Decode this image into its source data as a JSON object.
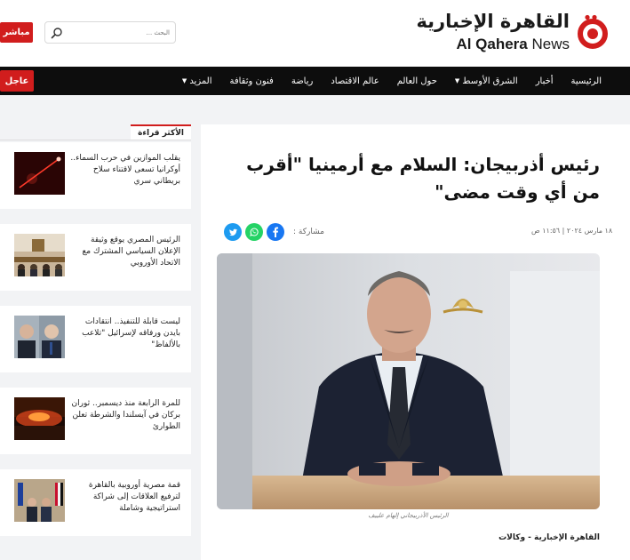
{
  "header": {
    "live_label": "مباشر",
    "search_placeholder": "البحث ...",
    "logo_ar": "القاهرة الإخبارية",
    "logo_en_bold": "Al Qahera",
    "logo_en_light": "News"
  },
  "nav": {
    "urgent_label": "عاجل",
    "items": [
      {
        "label": "الرئيسية"
      },
      {
        "label": "أخبار"
      },
      {
        "label": "الشرق الأوسط"
      },
      {
        "label": "حول العالم"
      },
      {
        "label": "عالم الاقتصاد"
      },
      {
        "label": "رياضة"
      },
      {
        "label": "فنون وثقافة"
      },
      {
        "label": "المزيد"
      }
    ]
  },
  "sidebar": {
    "title": "الأكثر قراءة",
    "items": [
      {
        "text": "يقلب الموازين في حرب السماء.. أوكرانيا تسعى لاقتناء سلاح بريطاني سري"
      },
      {
        "text": "الرئيس المصري يوقع وثيقة الإعلان السياسي المشترك مع الاتحاد الأوروبي"
      },
      {
        "text": "ليست قابلة للتنفيذ.. انتقادات بايدن ورفاقه لإسرائيل \"تلاعب بالألفاظ\""
      },
      {
        "text": "للمرة الرابعة منذ ديسمبر.. ثوران بركان في آيسلندا والشرطة تعلن الطوارئ"
      },
      {
        "text": "قمة مصرية أوروبية بالقاهرة لترفيع العلاقات إلى شراكة استراتيجية وشاملة"
      }
    ]
  },
  "article": {
    "headline": "رئيس أذربيجان: السلام مع أرمينيا \"أقرب من أي وقت مضى\"",
    "date": "١٨ مارس ٢٠٢٤ | ١١:٥٦ ص",
    "share_label": "مشاركة :",
    "caption": "الرئيس الأذربيجاني إلهام علييف",
    "source": "القاهرة الإخبارية - وكالات"
  },
  "colors": {
    "brand_red": "#d11d1d",
    "nav_bg": "#0d0d0d",
    "facebook": "#1877f2",
    "whatsapp": "#25d366",
    "twitter": "#1d9bf0"
  }
}
